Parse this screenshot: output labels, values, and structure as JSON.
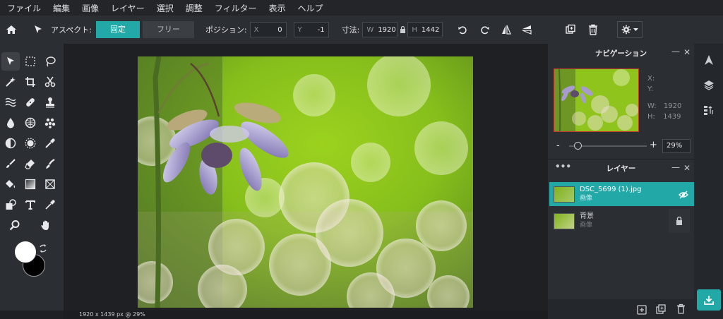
{
  "menu": [
    "ファイル",
    "編集",
    "画像",
    "レイヤー",
    "選択",
    "調整",
    "フィルター",
    "表示",
    "ヘルプ"
  ],
  "options": {
    "aspect_label": "アスペクト:",
    "fixed_label": "固定",
    "free_label": "フリー",
    "position_label": "ポジション:",
    "x_key": "X",
    "x_value": "0",
    "y_key": "Y",
    "y_value": "-1",
    "size_label": "寸法:",
    "w_key": "W",
    "w_value": "1920",
    "h_key": "H",
    "h_value": "1442"
  },
  "navigator": {
    "title": "ナビゲーション",
    "x_label": "X:",
    "y_label": "Y:",
    "w_label": "W:",
    "w_value": "1920",
    "h_label": "H:",
    "h_value": "1439",
    "zoom_value": "29%",
    "zoom_fraction": 0.06,
    "minus": "-",
    "plus": "+"
  },
  "layers": {
    "title": "レイヤー",
    "items": [
      {
        "name": "DSC_5699 (1).jpg",
        "type": "画像"
      },
      {
        "name": "背景",
        "type": "画像"
      }
    ]
  },
  "status": "1920 x 1439 px @ 29%",
  "colors": {
    "accent": "#23a8a8",
    "foreground": "#ffffff",
    "background": "#000000"
  }
}
